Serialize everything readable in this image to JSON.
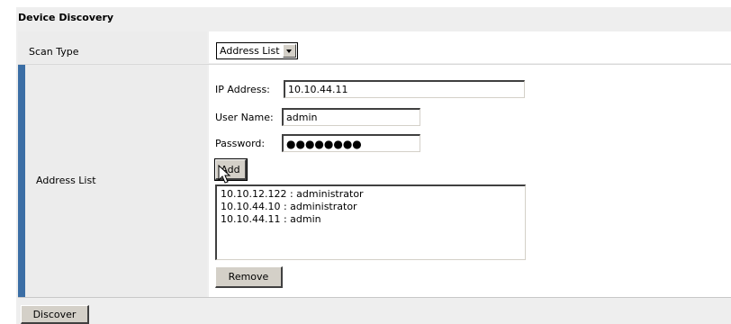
{
  "panel": {
    "title": "Device Discovery"
  },
  "scan_type": {
    "label": "Scan Type",
    "selected": "Address List"
  },
  "address_list": {
    "label": "Address List",
    "ip_label": "IP Address:",
    "ip_value": "10.10.44.11",
    "user_label": "User Name:",
    "user_value": "admin",
    "password_label": "Password:",
    "password_mask": "●●●●●●●●",
    "add_label": "Add",
    "entries": [
      "10.10.12.122 : administrator",
      "10.10.44.10 : administrator",
      "10.10.44.11 : admin"
    ],
    "remove_label": "Remove"
  },
  "footer": {
    "discover_label": "Discover"
  },
  "colors": {
    "accent_bar": "#3b6ea5",
    "panel_bg": "#eeeeee",
    "button_face": "#d4d0c8"
  }
}
